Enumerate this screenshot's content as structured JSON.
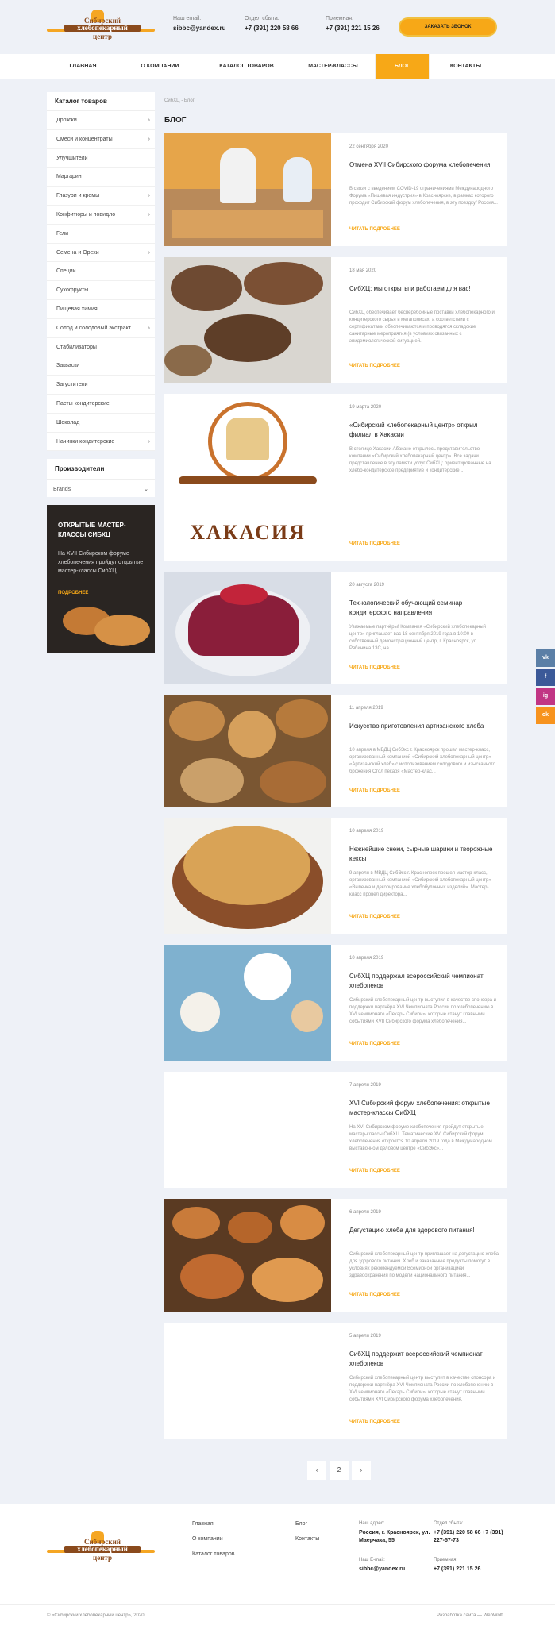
{
  "brand": {
    "logo_lines": [
      "Сибирский",
      "хлебопекарный",
      "центр"
    ],
    "accent": "#f7a817",
    "logo_brown": "#8a4a1c"
  },
  "header": {
    "email_caption": "Наш email:",
    "email": "sibbc@yandex.ru",
    "sales_caption": "Отдел сбыта:",
    "sales_phone": "+7 (391) 220 58 66",
    "reception_caption": "Приемная:",
    "reception_phone": "+7 (391) 221 15 26",
    "call_button": "ЗАКАЗАТЬ ЗВОНОК"
  },
  "nav": {
    "items": [
      "ГЛАВНАЯ",
      "О КОМПАНИИ",
      "КАТАЛОГ ТОВАРОВ",
      "МАСТЕР-КЛАССЫ",
      "БЛОГ",
      "КОНТАКТЫ"
    ],
    "active": "БЛОГ"
  },
  "catalog": {
    "title": "Каталог товаров",
    "items": [
      {
        "label": "Дрожжи",
        "has_sub": true
      },
      {
        "label": "Смеси и концентраты",
        "has_sub": true
      },
      {
        "label": "Улучшители",
        "has_sub": false
      },
      {
        "label": "Маргарин",
        "has_sub": false
      },
      {
        "label": "Глазури и кремы",
        "has_sub": true
      },
      {
        "label": "Конфитюры и повидло",
        "has_sub": true
      },
      {
        "label": "Гели",
        "has_sub": false
      },
      {
        "label": "Семена и Орехи",
        "has_sub": true
      },
      {
        "label": "Специи",
        "has_sub": false
      },
      {
        "label": "Сухофрукты",
        "has_sub": false
      },
      {
        "label": "Пищевая химия",
        "has_sub": false
      },
      {
        "label": "Солод и солодовый экстракт",
        "has_sub": true
      },
      {
        "label": "Стабилизаторы",
        "has_sub": false
      },
      {
        "label": "Закваски",
        "has_sub": false
      },
      {
        "label": "Загустители",
        "has_sub": false
      },
      {
        "label": "Пасты кондитерские",
        "has_sub": false
      },
      {
        "label": "Шоколад",
        "has_sub": false
      },
      {
        "label": "Начинки кондитерские",
        "has_sub": true
      }
    ]
  },
  "manufacturers": {
    "title": "Производители",
    "select_value": "Brands"
  },
  "promo": {
    "title": "ОТКРЫТЫЕ МАСТЕР-КЛАССЫ СИБХЦ",
    "text": "На XVII Сибирском форуме хлебопечения пройдут открытые мастер-классы СибХЦ",
    "link": "ПОДРОБНЕЕ"
  },
  "breadcrumb": "СибХЦ - Блог",
  "page_title": "БЛОГ",
  "read_more": "ЧИТАТЬ ПОДРОБНЕЕ",
  "posts": [
    {
      "date": "22 сентября 2020",
      "title": "Отмена XVII Сибирского форума хлебопечения",
      "excerpt": "В связи с введением COVID-19 ограничениями Международного Форума «Пищевая индустрия» в Красноярске, в рамках которого проходит Сибирский форум хлебопечения, в эту поездку/ Россия...",
      "image": "bakers-at-counter"
    },
    {
      "date": "18 мая 2020",
      "title": "СибХЦ: мы открыты и работаем для вас!",
      "excerpt": "СибХЦ обеспечивает бесперебойные поставки хлебопекарного и кондитерского сырья в мегаполисах, а соответствии с сертификатами обеспечиваются и проводятся складские санитарные мероприятия (в условиях связанных с эпидемиологической ситуацией.",
      "image": "rye-bread-loaves"
    },
    {
      "date": "19 марта 2020",
      "title": "«Сибирский хлебопекарный центр» открыл филиал в Хакасии",
      "excerpt": "В столице Хакасии Абакане открылось представительство компании «Сибирский хлебопекарный центр». Все задачи представление в эту памяти услуг СибХЦ: ориентированные на хлебо-кондитерское предприятие и кондитерские ...",
      "image": "khakasia-logo"
    },
    {
      "date": "20 августа 2019",
      "title": "Технологический обучающий семинар кондитерского направления",
      "excerpt": "Уважаемые партнёры! Компания «Сибирский хлебопекарный центр» приглашает вас 18 сентября 2019 года в 10:00 в собственный демонстрационный центр, г. Красноярск, ул. Рябинина 13С, на ...",
      "image": "berry-cake"
    },
    {
      "date": "11 апреля 2019",
      "title": "Искусство приготовления артизанского хлеба",
      "excerpt": "10 апреля в МВДЦ СибЭкс г. Красноярск прошел мастер-класс, организованный компанией «Сибирский хлебопекарный центр» «Артизанский хлеб» с использованием солодового и изысканного брожения Стол пекаря «Мастер-клас...",
      "image": "artisan-bread"
    },
    {
      "date": "10 апреля 2019",
      "title": "Нежнейшие снеки, сырные шарики и творожные кексы",
      "excerpt": "9 апреля в МВДЦ СибЭкс г. Красноярск прошел мастер-класс, организованный компанией «Сибирский хлебопекарный центр» «Выпечка и декорирование хлебобулочных изделий». Мастер-класс провел директора...",
      "image": "snacks-bowl"
    },
    {
      "date": "10 апреля 2019",
      "title": "СибХЦ поддержал всероссийский чемпионат хлебопеков",
      "excerpt": "Сибирский хлебопекарный центр выступил в качестве спонсора и поддержки партнёра XVI Чемпионата России по хлебопечению в XVI чемпионате «Пекарь Сибири», которые станут главными событиями XVII Сибирского форума хлебопечения...",
      "image": "baking-table"
    },
    {
      "date": "7 апреля 2019",
      "title": "XVI Сибирский форум хлебопечения: открытые мастер-классы СибХЦ",
      "excerpt": "На XVI Сибирском форуме хлебопечения пройдут открытые мастер-классы СибХЦ. Тематические XVI Сибирский форум хлебопечения откроется 10 апреля 2019 года в Международном выставочном деловом центре «СибЭкс»...",
      "image": ""
    },
    {
      "date": "6 апреля 2019",
      "title": "Дегустацию хлеба для здорового питания!",
      "excerpt": "Сибирский хлебопекарный центр приглашает на дегустацию хлеба для здорового питания. Хлеб и заказанные продукты помогут в условиях рекомендуемой Всемирной организацией здравоохранения по модели национального питания...",
      "image": "assorted-pastries"
    },
    {
      "date": "5 апреля 2019",
      "title": "СибХЦ поддержит всероссийский чемпионат хлебопеков",
      "excerpt": "Сибирский хлебопекарный центр выступит в качестве спонсора и поддержки партнёра XVI Чемпионата России по хлебопечению в XVI чемпионате «Пекарь Сибири», которые станут главными событиями XVI Сибирского форума хлебопечения.",
      "image": ""
    }
  ],
  "pagination": {
    "prev": "‹",
    "page": "2",
    "next": "›"
  },
  "social": [
    {
      "label": "vk",
      "color": "#5b7fa6"
    },
    {
      "label": "f",
      "color": "#3b5998"
    },
    {
      "label": "ig",
      "color": "#c13584"
    },
    {
      "label": "ok",
      "color": "#f7931e"
    }
  ],
  "footer": {
    "links_col1": [
      "Главная",
      "О компании",
      "Каталог товаров"
    ],
    "links_col2": [
      "Блог",
      "Контакты"
    ],
    "address_caption": "Наш адрес:",
    "address": "Россия, г. Красноярск, ул. Маерчака, 55",
    "email_caption": "Наш E-mail:",
    "email": "sibbc@yandex.ru",
    "sales_caption": "Отдел сбыта:",
    "sales_phones": "+7 (391) 220 58 66 +7 (391) 227-57-73",
    "reception_caption": "Приемная:",
    "reception_phone": "+7 (391) 221 15 26",
    "copyright": "© «Сибирский хлебопекарный центр», 2020.",
    "developer": "Разработка сайта — WebWolf"
  }
}
